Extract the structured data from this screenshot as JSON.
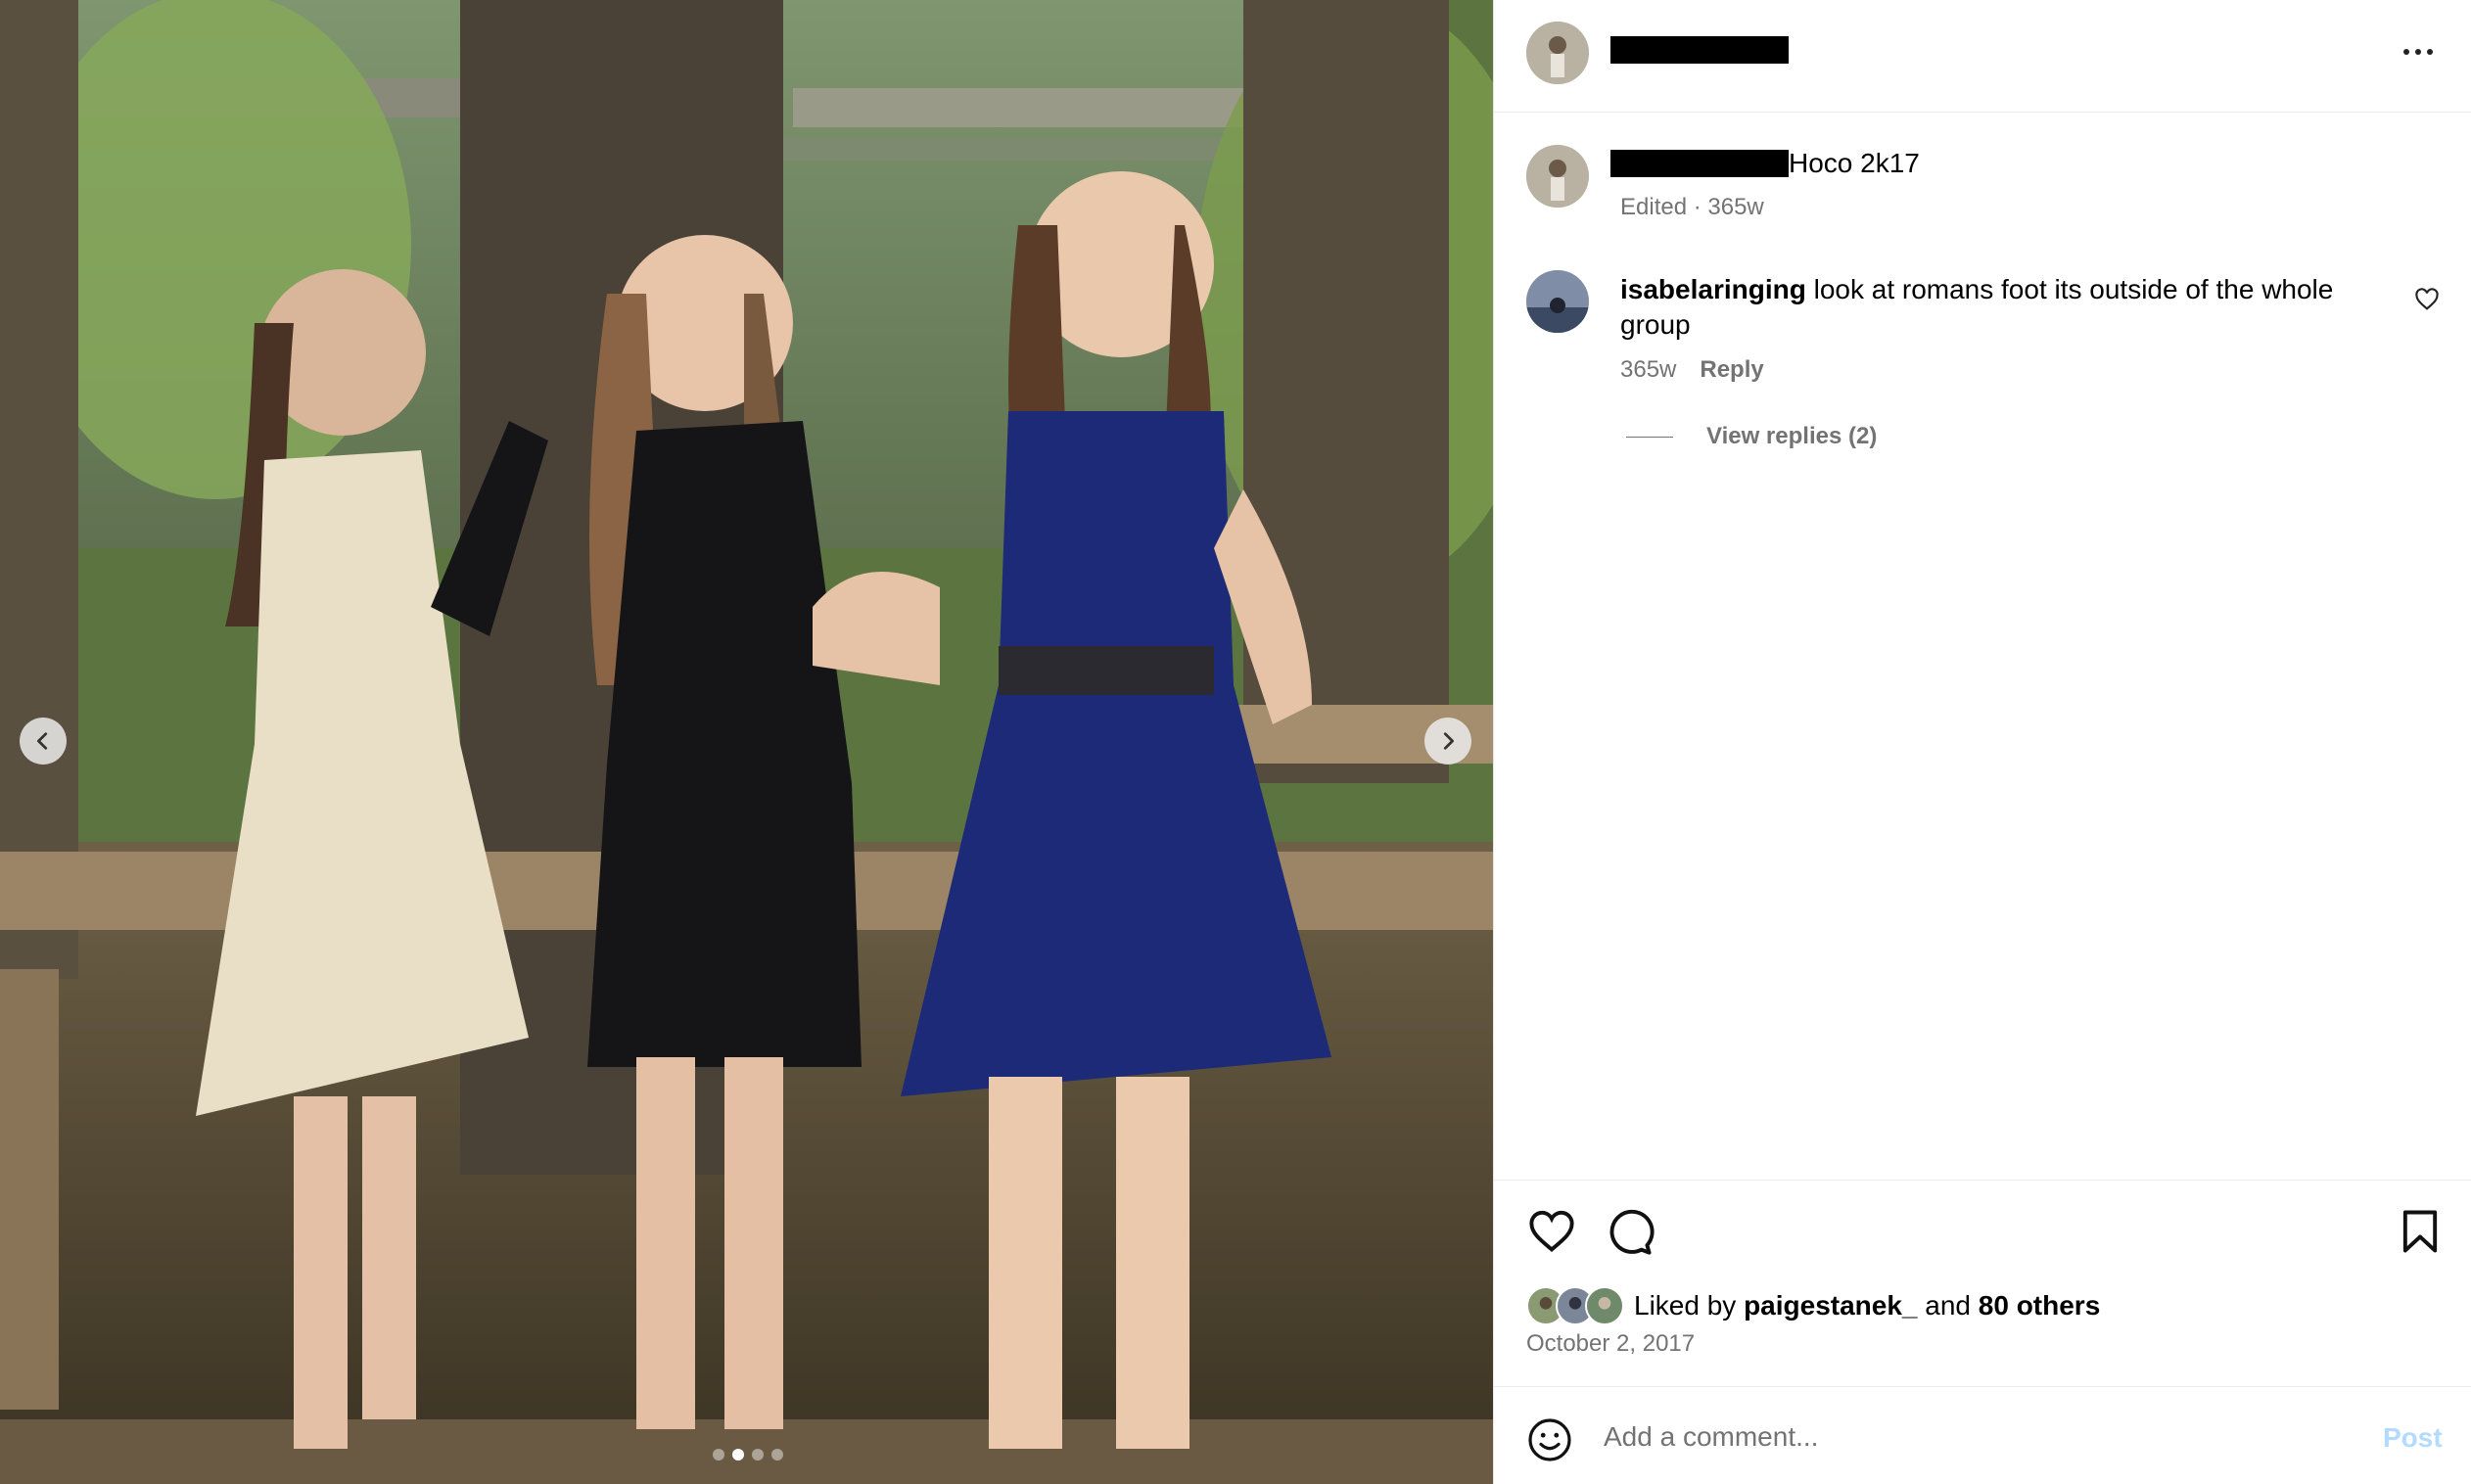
{
  "post": {
    "author_avatar": "author-avatar",
    "more_icon": "more-options-icon"
  },
  "media": {
    "prev_icon": "chevron-left-icon",
    "next_icon": "chevron-right-icon",
    "slide_count": 4,
    "active_slide": 2
  },
  "caption": {
    "text": "Hoco 2k17",
    "meta": "Edited · 365w"
  },
  "comments": [
    {
      "username": "isabelaringing",
      "text": "look at romans foot its outside of the whole group",
      "time": "365w",
      "reply_label": "Reply",
      "view_replies": "View replies (2)",
      "like_icon": "heart-icon"
    }
  ],
  "actions": {
    "like_icon": "heart-icon",
    "comment_icon": "comment-icon",
    "save_icon": "bookmark-icon"
  },
  "likes": {
    "prefix": "Liked by",
    "user": "paigestanek_",
    "joiner": "and",
    "others": "80 others"
  },
  "date": "October 2, 2017",
  "add_comment": {
    "placeholder": "Add a comment...",
    "post_label": "Post",
    "emoji_icon": "emoji-icon"
  },
  "colors": {
    "secondary_text": "#737373",
    "divider": "#ececec",
    "post_button_disabled": "#b3dbff"
  }
}
